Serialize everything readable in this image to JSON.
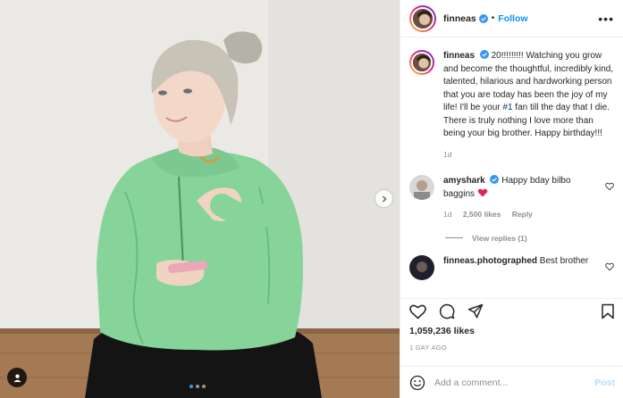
{
  "post": {
    "photo_alt": "",
    "carousel": {
      "total": 3,
      "active": 1
    }
  },
  "header": {
    "username": "finneas",
    "separator": "•",
    "follow_label": "Follow",
    "more_label": "•••"
  },
  "caption": {
    "username": "finneas",
    "text_before_tag": "20!!!!!!!!! Watching you grow and become the thoughtful, incredibly kind, talented, hilarious and hardworking person that you are today has been the joy of my life! I'll be your ",
    "hashtag": "#1",
    "text_after_tag": " fan till the day that I die. There is truly nothing I love more than being your big brother. Happy birthday!!!",
    "age": "1d"
  },
  "comments": [
    {
      "username": "amyshark",
      "text": "Happy bday bilbo baggins",
      "age": "1d",
      "likes": "2,500 likes",
      "reply_label": "Reply",
      "view_replies": "View replies (1)"
    },
    {
      "username": "finneas.photographed",
      "text": "Best brother"
    }
  ],
  "actions": {
    "likes": "1,059,236 likes",
    "time": "1 DAY AGO"
  },
  "composer": {
    "placeholder": "Add a comment...",
    "post_label": "Post"
  },
  "colors": {
    "accent": "#0095f6",
    "verified": "#3897f0",
    "post_disabled": "#b2dffc",
    "muted": "#8e8e8e"
  },
  "icons": [
    "verified-icon",
    "more-icon",
    "heart-icon",
    "comment-icon",
    "share-icon",
    "bookmark-icon",
    "emoji-icon",
    "chevron-right-icon",
    "user-tag-icon"
  ]
}
